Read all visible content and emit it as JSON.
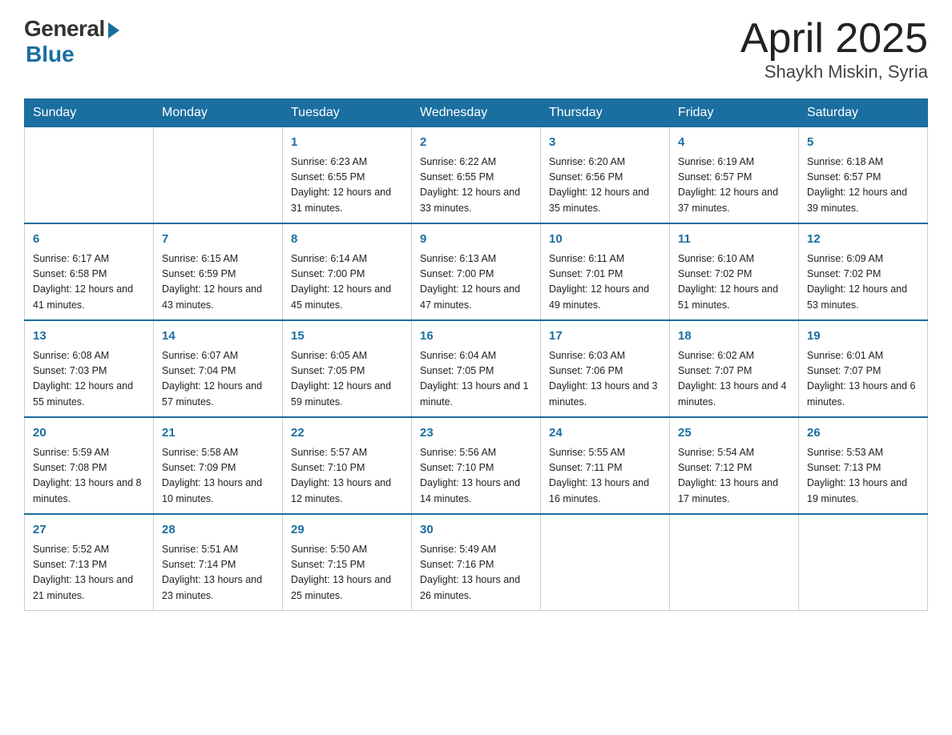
{
  "logo": {
    "general": "General",
    "blue": "Blue"
  },
  "title": "April 2025",
  "location": "Shaykh Miskin, Syria",
  "weekdays": [
    "Sunday",
    "Monday",
    "Tuesday",
    "Wednesday",
    "Thursday",
    "Friday",
    "Saturday"
  ],
  "weeks": [
    [
      {
        "day": "",
        "sunrise": "",
        "sunset": "",
        "daylight": ""
      },
      {
        "day": "",
        "sunrise": "",
        "sunset": "",
        "daylight": ""
      },
      {
        "day": "1",
        "sunrise": "Sunrise: 6:23 AM",
        "sunset": "Sunset: 6:55 PM",
        "daylight": "Daylight: 12 hours and 31 minutes."
      },
      {
        "day": "2",
        "sunrise": "Sunrise: 6:22 AM",
        "sunset": "Sunset: 6:55 PM",
        "daylight": "Daylight: 12 hours and 33 minutes."
      },
      {
        "day": "3",
        "sunrise": "Sunrise: 6:20 AM",
        "sunset": "Sunset: 6:56 PM",
        "daylight": "Daylight: 12 hours and 35 minutes."
      },
      {
        "day": "4",
        "sunrise": "Sunrise: 6:19 AM",
        "sunset": "Sunset: 6:57 PM",
        "daylight": "Daylight: 12 hours and 37 minutes."
      },
      {
        "day": "5",
        "sunrise": "Sunrise: 6:18 AM",
        "sunset": "Sunset: 6:57 PM",
        "daylight": "Daylight: 12 hours and 39 minutes."
      }
    ],
    [
      {
        "day": "6",
        "sunrise": "Sunrise: 6:17 AM",
        "sunset": "Sunset: 6:58 PM",
        "daylight": "Daylight: 12 hours and 41 minutes."
      },
      {
        "day": "7",
        "sunrise": "Sunrise: 6:15 AM",
        "sunset": "Sunset: 6:59 PM",
        "daylight": "Daylight: 12 hours and 43 minutes."
      },
      {
        "day": "8",
        "sunrise": "Sunrise: 6:14 AM",
        "sunset": "Sunset: 7:00 PM",
        "daylight": "Daylight: 12 hours and 45 minutes."
      },
      {
        "day": "9",
        "sunrise": "Sunrise: 6:13 AM",
        "sunset": "Sunset: 7:00 PM",
        "daylight": "Daylight: 12 hours and 47 minutes."
      },
      {
        "day": "10",
        "sunrise": "Sunrise: 6:11 AM",
        "sunset": "Sunset: 7:01 PM",
        "daylight": "Daylight: 12 hours and 49 minutes."
      },
      {
        "day": "11",
        "sunrise": "Sunrise: 6:10 AM",
        "sunset": "Sunset: 7:02 PM",
        "daylight": "Daylight: 12 hours and 51 minutes."
      },
      {
        "day": "12",
        "sunrise": "Sunrise: 6:09 AM",
        "sunset": "Sunset: 7:02 PM",
        "daylight": "Daylight: 12 hours and 53 minutes."
      }
    ],
    [
      {
        "day": "13",
        "sunrise": "Sunrise: 6:08 AM",
        "sunset": "Sunset: 7:03 PM",
        "daylight": "Daylight: 12 hours and 55 minutes."
      },
      {
        "day": "14",
        "sunrise": "Sunrise: 6:07 AM",
        "sunset": "Sunset: 7:04 PM",
        "daylight": "Daylight: 12 hours and 57 minutes."
      },
      {
        "day": "15",
        "sunrise": "Sunrise: 6:05 AM",
        "sunset": "Sunset: 7:05 PM",
        "daylight": "Daylight: 12 hours and 59 minutes."
      },
      {
        "day": "16",
        "sunrise": "Sunrise: 6:04 AM",
        "sunset": "Sunset: 7:05 PM",
        "daylight": "Daylight: 13 hours and 1 minute."
      },
      {
        "day": "17",
        "sunrise": "Sunrise: 6:03 AM",
        "sunset": "Sunset: 7:06 PM",
        "daylight": "Daylight: 13 hours and 3 minutes."
      },
      {
        "day": "18",
        "sunrise": "Sunrise: 6:02 AM",
        "sunset": "Sunset: 7:07 PM",
        "daylight": "Daylight: 13 hours and 4 minutes."
      },
      {
        "day": "19",
        "sunrise": "Sunrise: 6:01 AM",
        "sunset": "Sunset: 7:07 PM",
        "daylight": "Daylight: 13 hours and 6 minutes."
      }
    ],
    [
      {
        "day": "20",
        "sunrise": "Sunrise: 5:59 AM",
        "sunset": "Sunset: 7:08 PM",
        "daylight": "Daylight: 13 hours and 8 minutes."
      },
      {
        "day": "21",
        "sunrise": "Sunrise: 5:58 AM",
        "sunset": "Sunset: 7:09 PM",
        "daylight": "Daylight: 13 hours and 10 minutes."
      },
      {
        "day": "22",
        "sunrise": "Sunrise: 5:57 AM",
        "sunset": "Sunset: 7:10 PM",
        "daylight": "Daylight: 13 hours and 12 minutes."
      },
      {
        "day": "23",
        "sunrise": "Sunrise: 5:56 AM",
        "sunset": "Sunset: 7:10 PM",
        "daylight": "Daylight: 13 hours and 14 minutes."
      },
      {
        "day": "24",
        "sunrise": "Sunrise: 5:55 AM",
        "sunset": "Sunset: 7:11 PM",
        "daylight": "Daylight: 13 hours and 16 minutes."
      },
      {
        "day": "25",
        "sunrise": "Sunrise: 5:54 AM",
        "sunset": "Sunset: 7:12 PM",
        "daylight": "Daylight: 13 hours and 17 minutes."
      },
      {
        "day": "26",
        "sunrise": "Sunrise: 5:53 AM",
        "sunset": "Sunset: 7:13 PM",
        "daylight": "Daylight: 13 hours and 19 minutes."
      }
    ],
    [
      {
        "day": "27",
        "sunrise": "Sunrise: 5:52 AM",
        "sunset": "Sunset: 7:13 PM",
        "daylight": "Daylight: 13 hours and 21 minutes."
      },
      {
        "day": "28",
        "sunrise": "Sunrise: 5:51 AM",
        "sunset": "Sunset: 7:14 PM",
        "daylight": "Daylight: 13 hours and 23 minutes."
      },
      {
        "day": "29",
        "sunrise": "Sunrise: 5:50 AM",
        "sunset": "Sunset: 7:15 PM",
        "daylight": "Daylight: 13 hours and 25 minutes."
      },
      {
        "day": "30",
        "sunrise": "Sunrise: 5:49 AM",
        "sunset": "Sunset: 7:16 PM",
        "daylight": "Daylight: 13 hours and 26 minutes."
      },
      {
        "day": "",
        "sunrise": "",
        "sunset": "",
        "daylight": ""
      },
      {
        "day": "",
        "sunrise": "",
        "sunset": "",
        "daylight": ""
      },
      {
        "day": "",
        "sunrise": "",
        "sunset": "",
        "daylight": ""
      }
    ]
  ]
}
